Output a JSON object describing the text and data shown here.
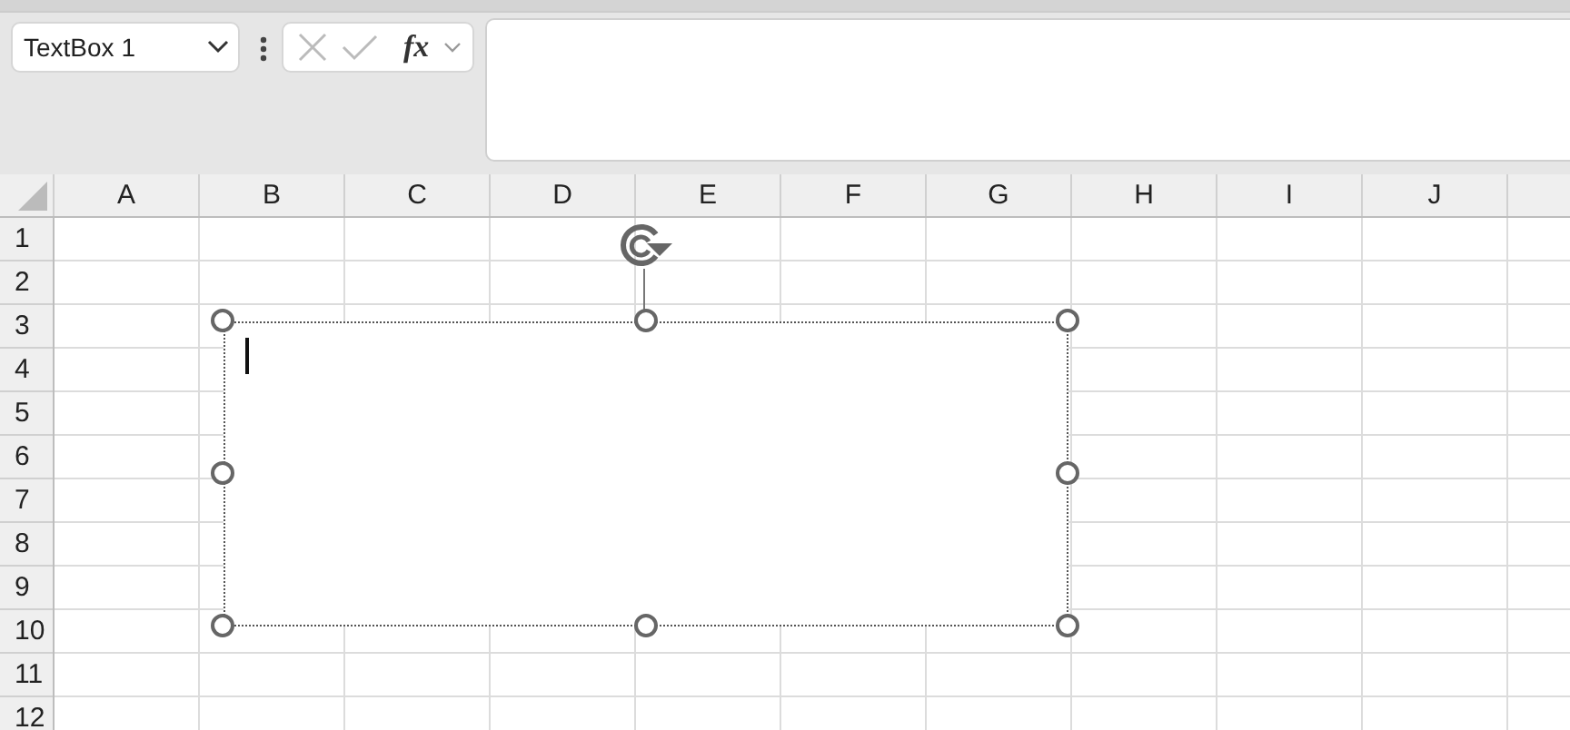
{
  "name_box": {
    "value": "TextBox 1"
  },
  "formula_bar": {
    "function_label": "fx"
  },
  "columns": [
    "A",
    "B",
    "C",
    "D",
    "E",
    "F",
    "G",
    "H",
    "I",
    "J"
  ],
  "rows": [
    "1",
    "2",
    "3",
    "4",
    "5",
    "6",
    "7",
    "8",
    "9",
    "10",
    "11",
    "12"
  ],
  "text_box": {
    "editing": true,
    "selected": true
  }
}
